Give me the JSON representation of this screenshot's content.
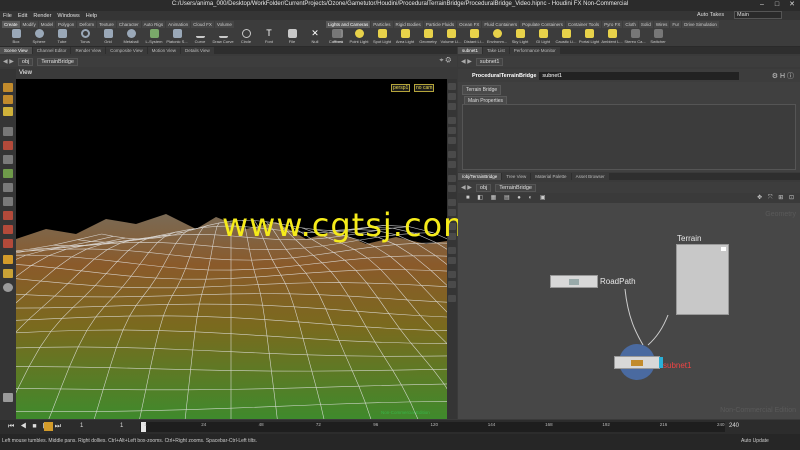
{
  "window": {
    "title": "C:/Users/anima_000/Desktop/WorkFolder/CurrentProjects/Ozone/Gametutor/Houdini/ProceduralTerrainBridge/ProceduralBridge_Video.hipnc - Houdini FX Non-Commercial"
  },
  "menu": {
    "items": [
      "File",
      "Edit",
      "Render",
      "Windows",
      "Help"
    ],
    "auto_takes": "Auto Takes",
    "desktop": "Main"
  },
  "shelf_left": {
    "tabs": [
      "Create",
      "Modify",
      "Model",
      "Polygon",
      "Deform",
      "Texture",
      "Character",
      "Auto Rigs",
      "Animation",
      "Cloud FX",
      "Volume"
    ],
    "tools": [
      "Box",
      "Sphere",
      "Tube",
      "Torus",
      "Grid",
      "Metaball",
      "L-System",
      "Platonic S...",
      "Curve",
      "Draw Curve",
      "Circle",
      "Font",
      "File",
      "Null",
      "Rivet"
    ]
  },
  "shelf_right": {
    "tabs": [
      "Lights and Cameras",
      "Particles",
      "Rigid Bodies",
      "Particle Fluids",
      "Ocean FX",
      "Fluid Containers",
      "Populate Containers",
      "Container Tools",
      "Pyro FX",
      "Cloth",
      "Solid",
      "Wires",
      "Fur",
      "Drive Simulation"
    ],
    "tools": [
      "Camera",
      "Point Light",
      "Spot Light",
      "Area Light",
      "Geometry",
      "Volume Li...",
      "Distant Li...",
      "Environm...",
      "Sky Light",
      "GI Light",
      "Caustic Li...",
      "Portal Light",
      "Ambient L...",
      "Stereo Ca...",
      "Switcher"
    ]
  },
  "left_panes": {
    "tabs": [
      "Scene View",
      "Channel Editor",
      "Render View",
      "Composite View",
      "Motion View",
      "Details View"
    ],
    "path_root": "obj",
    "path_node": "TerrainBridge"
  },
  "viewport": {
    "label": "View",
    "camera_persp": "persp1",
    "camera_nocam": "no cam",
    "watermark": "www.cgtsj.com",
    "non_commercial": "Non-Commercial Edition"
  },
  "param_pane": {
    "tabs": [
      "subnet1",
      "Take List",
      "Performance Monitor"
    ],
    "path_node": "subnet1",
    "node_type": "ProceduralTerrainBridge",
    "node_name": "subnet1",
    "section_tab": "Terrain Bridge",
    "folder_tab": "Main Properties"
  },
  "network_pane": {
    "tabs": [
      "/obj/TerrainBridge",
      "Tree View",
      "Material Palette",
      "Asset Browser"
    ],
    "path_root": "obj",
    "path_node": "TerrainBridge",
    "context": "Geometry",
    "nodes": {
      "roadpath": "RoadPath",
      "terrain": "Terrain",
      "subnet": "subnet1"
    },
    "non_commercial": "Non-Commercial Edition"
  },
  "playbar": {
    "frame": "1",
    "start": "1",
    "end": "240",
    "ticks": [
      "1",
      "24",
      "48",
      "72",
      "96",
      "120",
      "144",
      "168",
      "192",
      "216",
      "240"
    ],
    "auto_update": "Auto Update"
  },
  "status": "Left mouse tumbles. Middle pans. Right dollies. Ctrl+Alt+Left box-zooms. Ctrl+Right zooms. Spacebar-Ctrl-Left tilts."
}
